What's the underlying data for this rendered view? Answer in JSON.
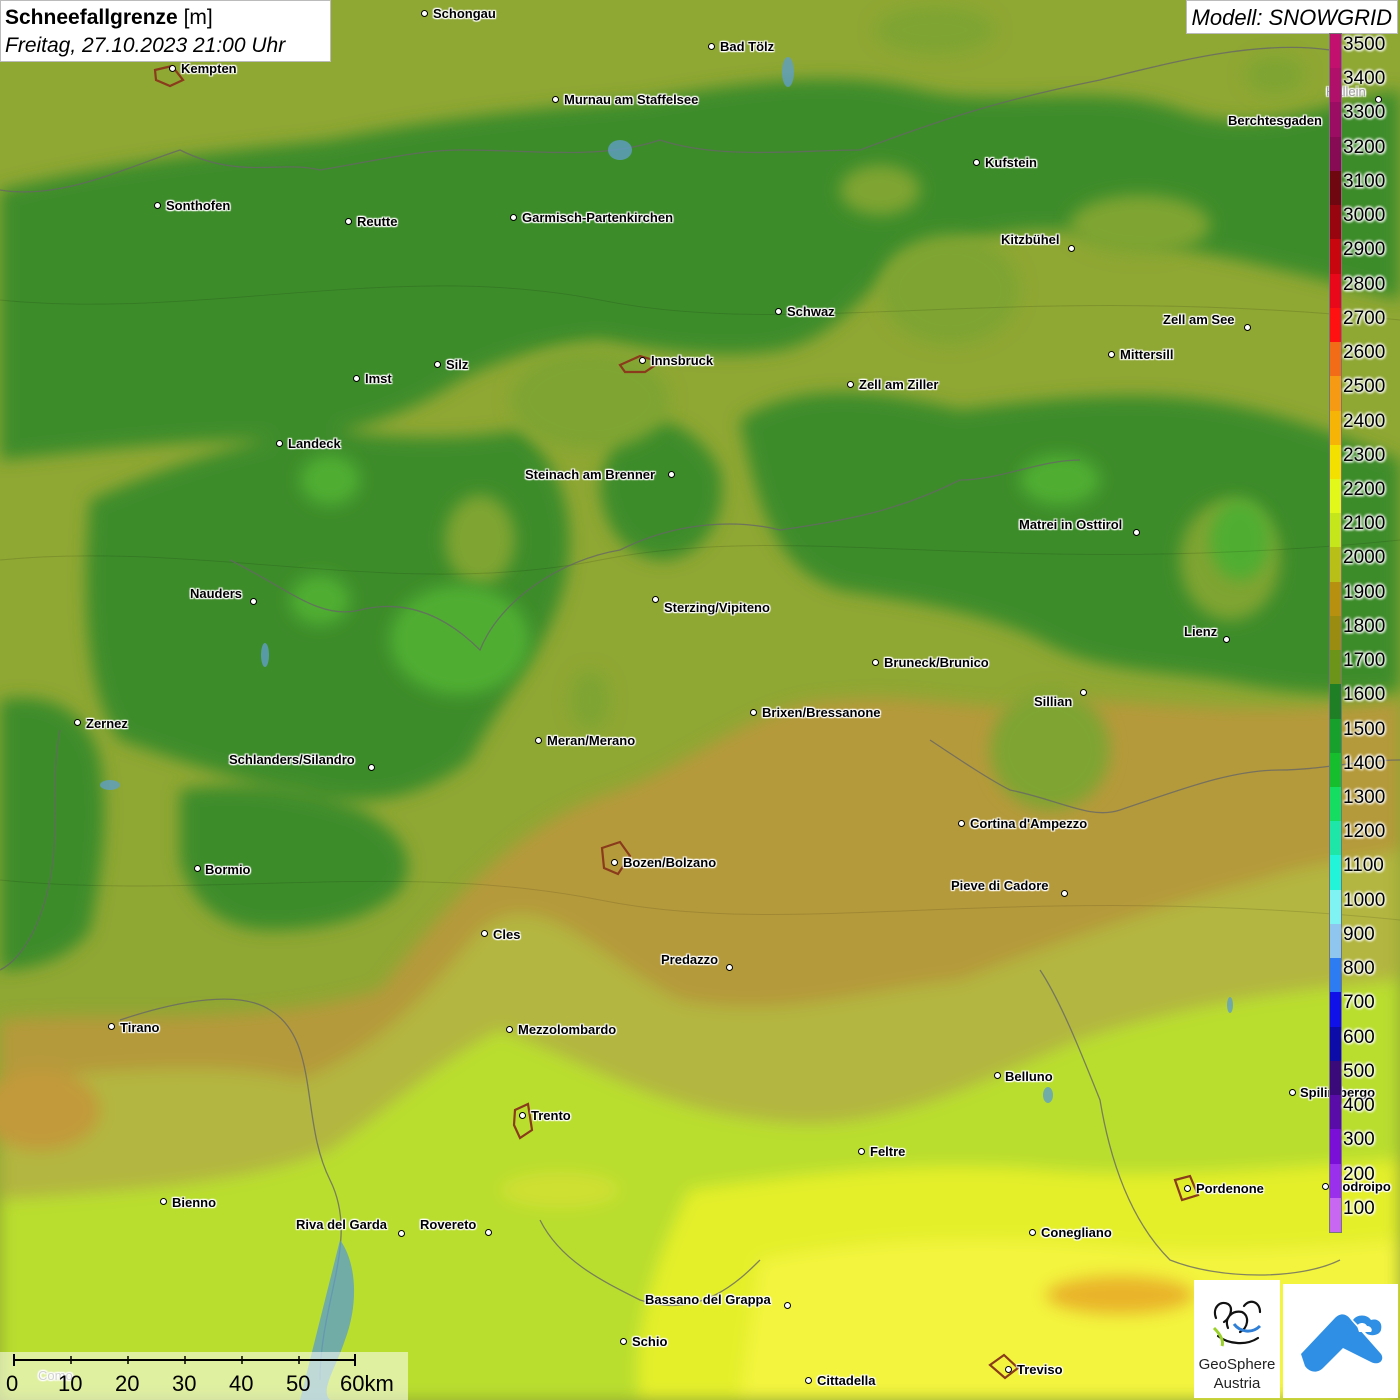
{
  "title": {
    "variable": "Schneefallgrenze",
    "unit": "[m]",
    "time": "Freitag, 27.10.2023 21:00 Uhr"
  },
  "model": {
    "label": "Modell: SNOWGRID"
  },
  "legend": {
    "levels": [
      "3500",
      "3400",
      "3300",
      "3200",
      "3100",
      "3000",
      "2900",
      "2800",
      "2700",
      "2600",
      "2500",
      "2400",
      "2300",
      "2200",
      "2100",
      "2000",
      "1900",
      "1800",
      "1700",
      "1600",
      "1500",
      "1400",
      "1300",
      "1200",
      "1100",
      "1000",
      "900",
      "800",
      "700",
      "600",
      "500",
      "400",
      "300",
      "200",
      "100"
    ],
    "colors": [
      "#c2106e",
      "#b0106a",
      "#9a0d62",
      "#870a55",
      "#6e0710",
      "#98050e",
      "#c8060e",
      "#e8081a",
      "#ff1111",
      "#f26b16",
      "#f59a12",
      "#f6b407",
      "#f4e000",
      "#e2f81a",
      "#c6e61c",
      "#b8c018",
      "#b89010",
      "#9a8c10",
      "#6c9418",
      "#1f7f25",
      "#17a02b",
      "#16be2e",
      "#15dd62",
      "#1ee6a8",
      "#22f4da",
      "#7ff2f4",
      "#8ec6ef",
      "#2e7cf2",
      "#1010e8",
      "#0c0ca8",
      "#3a0a7a",
      "#5a0ca8",
      "#7a10d8",
      "#9a30ec",
      "#c867f2"
    ]
  },
  "scalebar": {
    "labels": [
      "0",
      "10",
      "20",
      "30",
      "40",
      "50",
      "60km"
    ]
  },
  "logos": {
    "geosphere_line1": "GeoSphere",
    "geosphere_line2": "Austria"
  },
  "cities": [
    {
      "name": "Schongau",
      "dot": [
        424,
        13
      ],
      "lab": [
        433,
        6
      ]
    },
    {
      "name": "Kempten",
      "dot": [
        172,
        68
      ],
      "lab": [
        181,
        61
      ]
    },
    {
      "name": "Bad Tölz",
      "dot": [
        711,
        46
      ],
      "lab": [
        720,
        39
      ]
    },
    {
      "name": "Murnau am Staffelsee",
      "dot": [
        555,
        99
      ],
      "lab": [
        564,
        92
      ]
    },
    {
      "name": "Hallein",
      "dot": [
        1378,
        99
      ],
      "lab": [
        1326,
        84
      ]
    },
    {
      "name": "Berchtesgaden",
      "dot": null,
      "lab": [
        1228,
        113
      ]
    },
    {
      "name": "Kufstein",
      "dot": [
        976,
        162
      ],
      "lab": [
        985,
        155
      ]
    },
    {
      "name": "Sonthofen",
      "dot": [
        157,
        205
      ],
      "lab": [
        166,
        198
      ]
    },
    {
      "name": "Reutte",
      "dot": [
        348,
        221
      ],
      "lab": [
        357,
        214
      ]
    },
    {
      "name": "Garmisch-Partenkirchen",
      "dot": [
        513,
        217
      ],
      "lab": [
        522,
        210
      ]
    },
    {
      "name": "Kitzbühel",
      "dot": [
        1071,
        248
      ],
      "lab": [
        1001,
        232
      ]
    },
    {
      "name": "Schwaz",
      "dot": [
        778,
        311
      ],
      "lab": [
        787,
        304
      ]
    },
    {
      "name": "Zell am See",
      "dot": [
        1247,
        327
      ],
      "lab": [
        1163,
        312
      ]
    },
    {
      "name": "Mittersill",
      "dot": [
        1111,
        354
      ],
      "lab": [
        1120,
        347
      ]
    },
    {
      "name": "Innsbruck",
      "dot": [
        642,
        360
      ],
      "lab": [
        651,
        353
      ]
    },
    {
      "name": "Silz",
      "dot": [
        437,
        364
      ],
      "lab": [
        446,
        357
      ]
    },
    {
      "name": "Imst",
      "dot": [
        356,
        378
      ],
      "lab": [
        365,
        371
      ]
    },
    {
      "name": "Zell am Ziller",
      "dot": [
        850,
        384
      ],
      "lab": [
        859,
        377
      ]
    },
    {
      "name": "Landeck",
      "dot": [
        279,
        443
      ],
      "lab": [
        288,
        436
      ]
    },
    {
      "name": "Steinach am Brenner",
      "dot": [
        671,
        474
      ],
      "lab": [
        525,
        467
      ]
    },
    {
      "name": "Matrei in Osttirol",
      "dot": [
        1136,
        532
      ],
      "lab": [
        1019,
        517
      ]
    },
    {
      "name": "Nauders",
      "dot": [
        253,
        601
      ],
      "lab": [
        190,
        586
      ]
    },
    {
      "name": "Sterzing/Vipiteno",
      "dot": [
        655,
        599
      ],
      "lab": [
        664,
        600
      ]
    },
    {
      "name": "Lienz",
      "dot": [
        1226,
        639
      ],
      "lab": [
        1184,
        624
      ]
    },
    {
      "name": "Bruneck/Brunico",
      "dot": [
        875,
        662
      ],
      "lab": [
        884,
        655
      ]
    },
    {
      "name": "Sillian",
      "dot": [
        1083,
        692
      ],
      "lab": [
        1034,
        694
      ]
    },
    {
      "name": "Brixen/Bressanone",
      "dot": [
        753,
        712
      ],
      "lab": [
        762,
        705
      ]
    },
    {
      "name": "Zernez",
      "dot": [
        77,
        722
      ],
      "lab": [
        86,
        716
      ]
    },
    {
      "name": "Meran/Merano",
      "dot": [
        538,
        740
      ],
      "lab": [
        547,
        733
      ]
    },
    {
      "name": "Schlanders/Silandro",
      "dot": [
        371,
        767
      ],
      "lab": [
        229,
        752
      ]
    },
    {
      "name": "Cortina d'Ampezzo",
      "dot": [
        961,
        823
      ],
      "lab": [
        970,
        816
      ]
    },
    {
      "name": "Bozen/Bolzano",
      "dot": [
        614,
        862
      ],
      "lab": [
        623,
        855
      ]
    },
    {
      "name": "Bormio",
      "dot": [
        197,
        868
      ],
      "lab": [
        205,
        862
      ]
    },
    {
      "name": "Pieve di Cadore",
      "dot": [
        1064,
        893
      ],
      "lab": [
        951,
        878
      ]
    },
    {
      "name": "Cles",
      "dot": [
        484,
        933
      ],
      "lab": [
        493,
        927
      ]
    },
    {
      "name": "Predazzo",
      "dot": [
        729,
        967
      ],
      "lab": [
        661,
        952
      ]
    },
    {
      "name": "Tirano",
      "dot": [
        111,
        1026
      ],
      "lab": [
        120,
        1020
      ]
    },
    {
      "name": "Mezzolombardo",
      "dot": [
        509,
        1029
      ],
      "lab": [
        518,
        1022
      ]
    },
    {
      "name": "Belluno",
      "dot": [
        997,
        1075
      ],
      "lab": [
        1005,
        1069
      ]
    },
    {
      "name": "Spilimbergo",
      "dot": [
        1292,
        1092
      ],
      "lab": [
        1300,
        1085
      ]
    },
    {
      "name": "Trento",
      "dot": [
        522,
        1115
      ],
      "lab": [
        531,
        1108
      ]
    },
    {
      "name": "Feltre",
      "dot": [
        861,
        1151
      ],
      "lab": [
        870,
        1144
      ]
    },
    {
      "name": "Pordenone",
      "dot": [
        1187,
        1188
      ],
      "lab": [
        1196,
        1181
      ]
    },
    {
      "name": "Codroipo",
      "dot": [
        1325,
        1186
      ],
      "lab": [
        1333,
        1179
      ]
    },
    {
      "name": "Bienno",
      "dot": [
        163,
        1201
      ],
      "lab": [
        172,
        1195
      ]
    },
    {
      "name": "Riva del Garda",
      "dot": [
        401,
        1233
      ],
      "lab": [
        296,
        1217
      ]
    },
    {
      "name": "Rovereto",
      "dot": [
        488,
        1232
      ],
      "lab": [
        420,
        1217
      ]
    },
    {
      "name": "Conegliano",
      "dot": [
        1032,
        1232
      ],
      "lab": [
        1041,
        1225
      ]
    },
    {
      "name": "Bassano del Grappa",
      "dot": [
        787,
        1305
      ],
      "lab": [
        645,
        1292
      ]
    },
    {
      "name": "Schio",
      "dot": [
        623,
        1341
      ],
      "lab": [
        632,
        1334
      ]
    },
    {
      "name": "Treviso",
      "dot": [
        1008,
        1369
      ],
      "lab": [
        1017,
        1362
      ]
    },
    {
      "name": "Cittadella",
      "dot": [
        808,
        1380
      ],
      "lab": [
        817,
        1373
      ]
    },
    {
      "name": "Como",
      "dot": null,
      "lab": [
        38,
        1368
      ]
    }
  ]
}
